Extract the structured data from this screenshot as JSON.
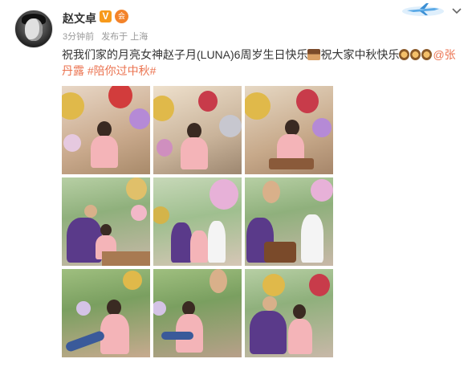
{
  "post": {
    "author": "赵文卓",
    "verified_badge": "V",
    "member_badge": "会",
    "time": "3分钟前",
    "location_label": "发布于 上海",
    "text_segments": {
      "part1": "祝我们家的月亮女神赵子月(LUNA)6周岁生日快乐",
      "part2": "祝大家中秋快乐",
      "mention_part1": "@张",
      "mention_part2": "丹露",
      "topic": "#陪你过中秋#"
    },
    "images": [
      {
        "name": "photo-1",
        "scene": "blowing-candles"
      },
      {
        "name": "photo-2",
        "scene": "blowing-candles"
      },
      {
        "name": "photo-3",
        "scene": "cutting-cake"
      },
      {
        "name": "photo-4",
        "scene": "family-table"
      },
      {
        "name": "photo-5",
        "scene": "family-standing"
      },
      {
        "name": "photo-6",
        "scene": "family-cake"
      },
      {
        "name": "photo-7",
        "scene": "garden-play"
      },
      {
        "name": "photo-8",
        "scene": "garden-play"
      },
      {
        "name": "photo-9",
        "scene": "family-close"
      }
    ]
  },
  "icons": {
    "chevron": "chevron-down-icon",
    "decoration": "airplane-icon",
    "emoji_cake": "cake-emoji-icon",
    "emoji_moon": "mooncake-emoji-icon"
  },
  "colors": {
    "link": "#eb7350",
    "text": "#333333",
    "meta": "#999999",
    "vbadge": "#f79a1b"
  }
}
